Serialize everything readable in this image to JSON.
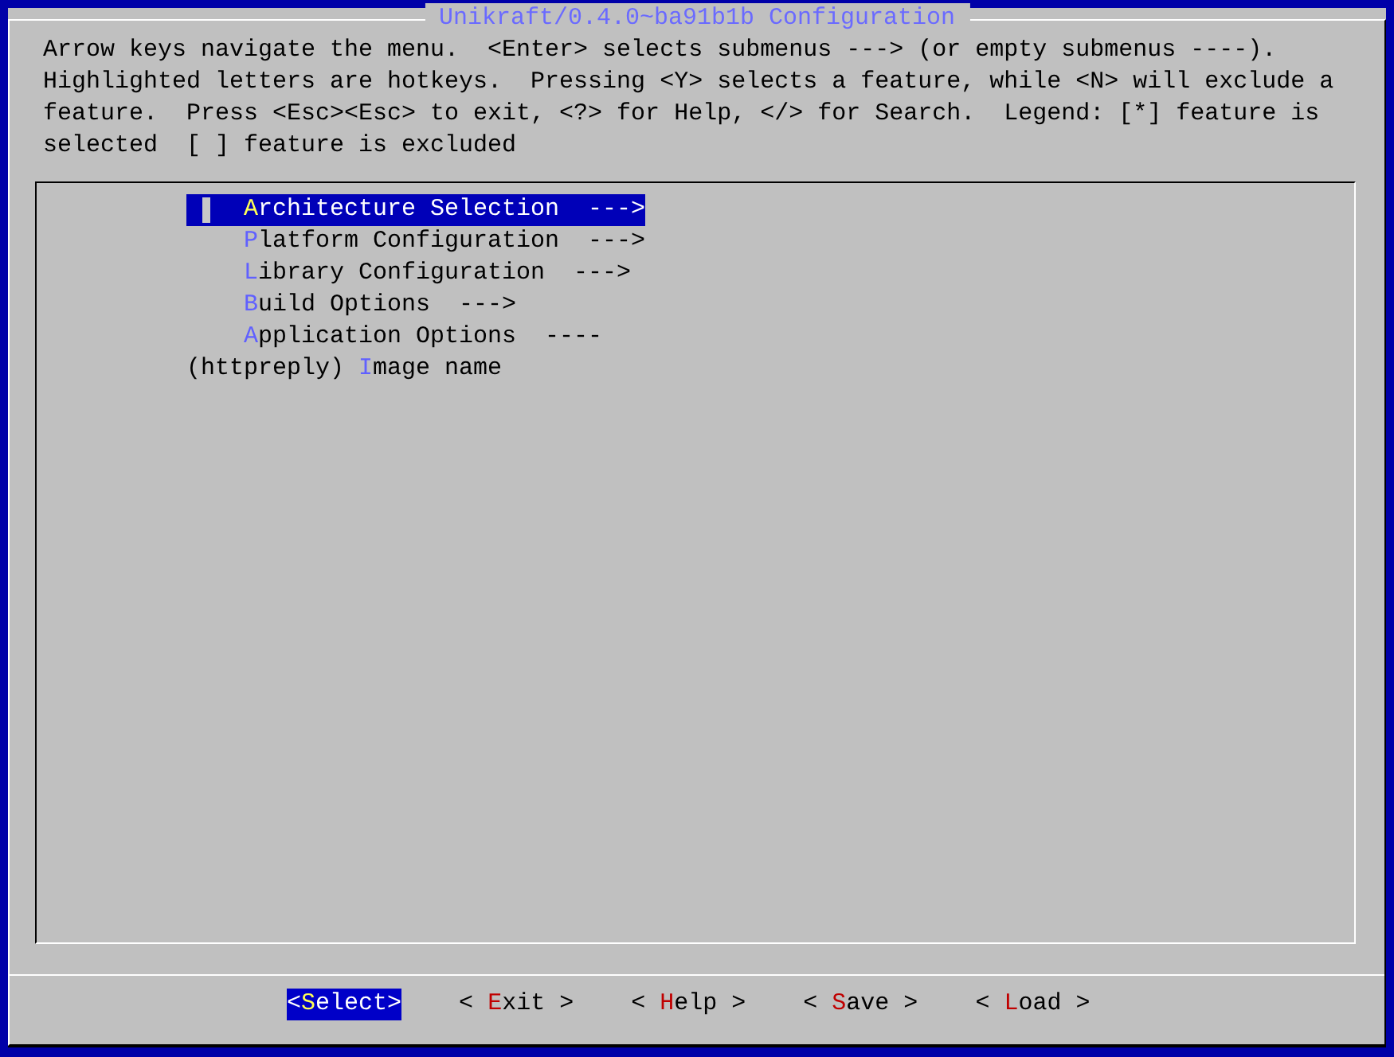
{
  "window": {
    "title": "Unikraft/0.4.0~ba91b1b Configuration"
  },
  "help_text": "Arrow keys navigate the menu.  <Enter> selects submenus ---> (or empty submenus ----).  Highlighted letters are hotkeys.  Pressing <Y> selects a feature, while <N> will exclude a feature.  Press <Esc><Esc> to exit, <?> for Help, </> for Search.  Legend: [*] feature is selected  [ ] feature is excluded",
  "menu": {
    "items": [
      {
        "hotkey": "A",
        "after": "rchitecture Selection",
        "suffix": "--->",
        "selected": true
      },
      {
        "hotkey": "P",
        "after": "latform Configuration",
        "suffix": "--->",
        "selected": false
      },
      {
        "hotkey": "L",
        "after": "ibrary Configuration",
        "suffix": "--->",
        "selected": false
      },
      {
        "hotkey": "B",
        "after": "uild Options",
        "suffix": "--->",
        "selected": false
      },
      {
        "hotkey": "A",
        "after": "pplication Options",
        "suffix": "----",
        "selected": false
      },
      {
        "prefix": "(httpreply) ",
        "hotkey": "I",
        "after": "mage name",
        "selected": false
      }
    ]
  },
  "buttons": [
    {
      "before": "<",
      "hotkey": "S",
      "after": "elect>",
      "selected": true
    },
    {
      "before": "< ",
      "hotkey": "E",
      "after": "xit >",
      "selected": false
    },
    {
      "before": "< ",
      "hotkey": "H",
      "after": "elp >",
      "selected": false
    },
    {
      "before": "< ",
      "hotkey": "S",
      "after": "ave >",
      "selected": false
    },
    {
      "before": "< ",
      "hotkey": "L",
      "after": "oad >",
      "selected": false
    }
  ]
}
